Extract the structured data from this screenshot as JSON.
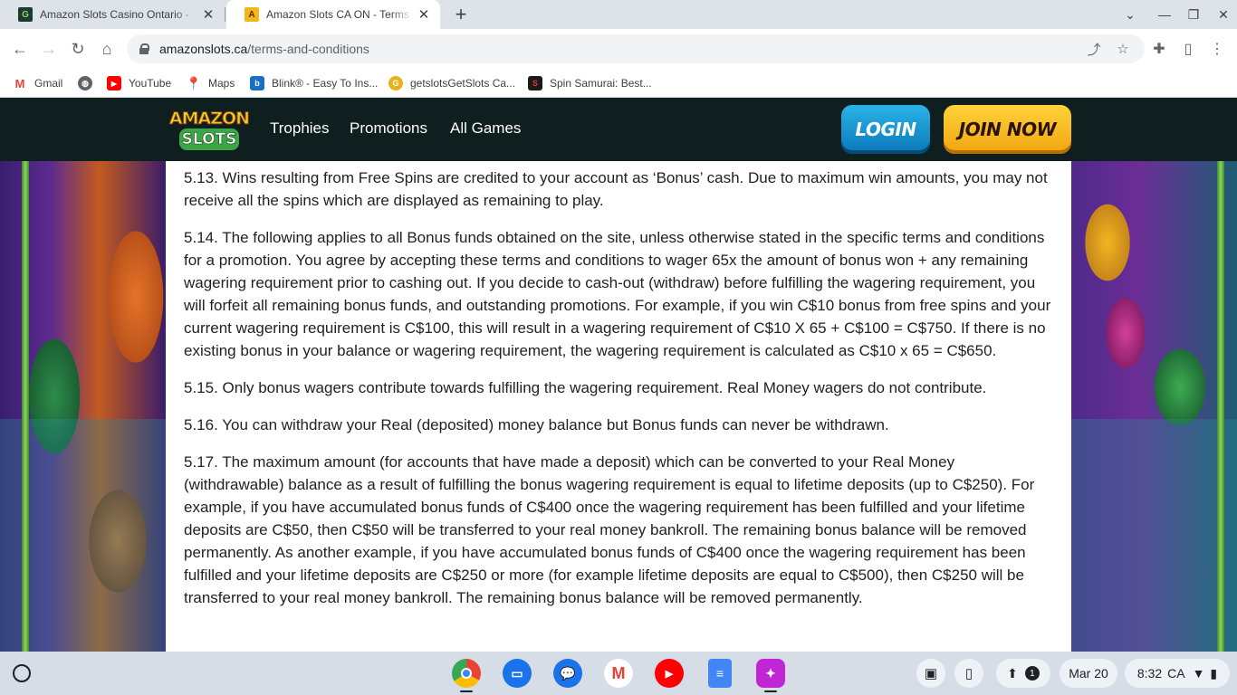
{
  "browser": {
    "tabs": [
      {
        "title": "Amazon Slots Casino Ontario -",
        "favicon": "getslots-favicon",
        "active": false
      },
      {
        "title": "Amazon Slots CA ON - Terms A",
        "favicon": "amazonslots-favicon",
        "active": true
      }
    ],
    "url_host": "amazonslots.ca",
    "url_path": "/terms-and-conditions",
    "bookmarks": [
      {
        "label": "Gmail",
        "icon": "gmail-icon"
      },
      {
        "label": "",
        "icon": "globe-icon"
      },
      {
        "label": "YouTube",
        "icon": "youtube-icon"
      },
      {
        "label": "Maps",
        "icon": "maps-icon"
      },
      {
        "label": "Blink® - Easy To Ins...",
        "icon": "blink-icon"
      },
      {
        "label": "getslotsGetSlots Ca...",
        "icon": "getslots-icon"
      },
      {
        "label": "Spin Samurai: Best...",
        "icon": "spin-samurai-icon"
      }
    ]
  },
  "site": {
    "logo": {
      "top": "AMAZON",
      "bottom": "SLOTS"
    },
    "nav": [
      "Trophies",
      "Promotions",
      "All Games"
    ],
    "login_label": "LOGIN",
    "join_label": "JOIN NOW",
    "colors": {
      "header_bg": "#0f1e1e",
      "login": "#1a95d2",
      "join": "#f7b81f"
    }
  },
  "terms": [
    "5.13. Wins resulting from Free Spins are credited to your account as ‘Bonus’ cash. Due to maximum win amounts, you may not receive all the spins which are displayed as remaining to play.",
    "5.14. The following applies to all Bonus funds obtained on the site, unless otherwise stated in the specific terms and conditions for a promotion. You agree by accepting these terms and conditions to wager 65x the amount of bonus won + any remaining wagering requirement prior to cashing out. If you decide to cash-out (withdraw) before fulfilling the wagering requirement, you will forfeit all remaining bonus funds, and outstanding promotions. For example, if you win C$10 bonus from free spins and your current wagering requirement is C$100, this will result in a wagering requirement of C$10 X 65 + C$100 = C$750. If there is no existing bonus in your balance or wagering requirement, the wagering requirement is calculated as C$10 x 65 = C$650.",
    "5.15. Only bonus wagers contribute towards fulfilling the wagering requirement. Real Money wagers do not contribute.",
    "5.16. You can withdraw your Real (deposited) money balance but Bonus funds can never be withdrawn.",
    "5.17. The maximum amount (for accounts that have made a deposit) which can be converted to your Real Money (withdrawable) balance as a result of fulfilling the bonus wagering requirement is equal to lifetime deposits (up to C$250). For example, if you have accumulated bonus funds of C$400 once the wagering requirement has been fulfilled and your lifetime deposits are C$50, then C$50 will be transferred to your real money bankroll. The remaining bonus balance will be removed permanently. As another example, if you have accumulated bonus funds of C$400 once the wagering requirement has been fulfilled and your lifetime deposits are C$250 or more (for example lifetime deposits are equal to C$500), then C$250 will be transferred to your real money bankroll. The remaining bonus balance will be removed permanently."
  ],
  "shelf": {
    "apps": [
      "chrome-icon",
      "files-icon",
      "messages-icon",
      "gmail-icon",
      "youtube-icon",
      "docs-icon",
      "screencast-icon"
    ],
    "notification_count": "1",
    "date": "Mar 20",
    "time": "8:32",
    "region": "CA"
  }
}
